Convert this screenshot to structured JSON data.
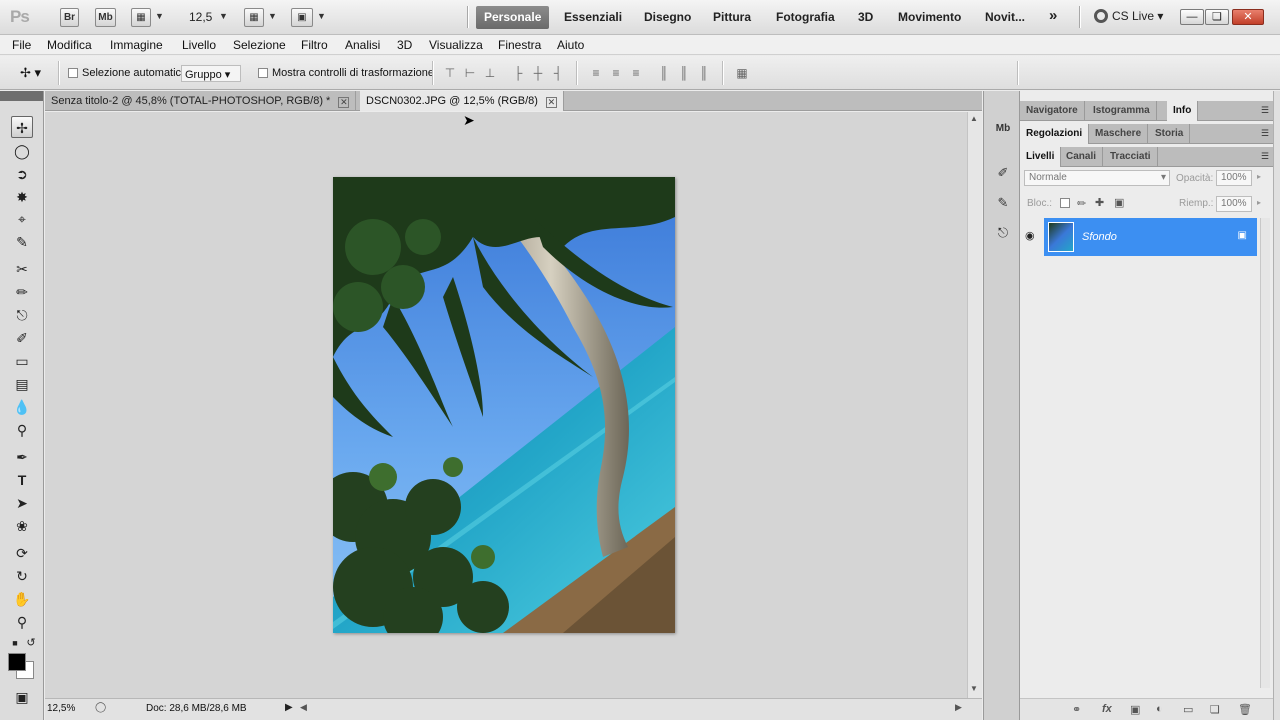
{
  "appbar": {
    "logo": "Ps",
    "br_button": "Br",
    "mb_button": "Mb",
    "zoom": "12,5",
    "workspaces": [
      "Personale",
      "Essenziali",
      "Disegno",
      "Pittura",
      "Fotografia",
      "3D",
      "Movimento",
      "Novit..."
    ],
    "more_icon": "»",
    "cslive": "CS Live",
    "window_buttons": [
      "minimize-icon",
      "restore-icon",
      "close-icon"
    ]
  },
  "menubar": {
    "items": [
      "File",
      "Modifica",
      "Immagine",
      "Livello",
      "Selezione",
      "Filtro",
      "Analisi",
      "3D",
      "Visualizza",
      "Finestra",
      "Aiuto"
    ]
  },
  "options": {
    "auto_select_label": "Selezione automatica:",
    "auto_select_value": "Gruppo",
    "show_transform_label": "Mostra controlli di trasformazione"
  },
  "tools": [
    "move-tool",
    "marquee-tool",
    "lasso-tool",
    "quick-selection-tool",
    "crop-tool",
    "eyedropper-tool",
    "healing-brush-tool",
    "brush-tool",
    "clone-stamp-tool",
    "history-brush-tool",
    "eraser-tool",
    "gradient-tool",
    "blur-tool",
    "dodge-tool",
    "pen-tool",
    "type-tool",
    "path-selection-tool",
    "custom-shape-tool",
    "3d-rotate-tool",
    "3d-orbit-tool",
    "hand-tool",
    "zoom-tool"
  ],
  "colors": {
    "foreground": "#000000",
    "background": "#ffffff",
    "layer_highlight": "#3c8ff2",
    "active_workspace": "#7a7a7a"
  },
  "document": {
    "tabs": [
      {
        "label": "Senza titolo-2 @ 45,8% (TOTAL-PHOTOSHOP, RGB/8) *"
      },
      {
        "label": "DSCN0302.JPG @ 12,5% (RGB/8)"
      }
    ]
  },
  "status": {
    "zoom": "12,5%",
    "doc_info": "Doc: 28,6 MB/28,6 MB"
  },
  "panels": {
    "top_tabs": [
      "Navigatore",
      "Istogramma",
      "Info"
    ],
    "mid_tabs": [
      "Regolazioni",
      "Maschere",
      "Storia"
    ],
    "layer_tabs": [
      "Livelli",
      "Canali",
      "Tracciati"
    ],
    "blend_mode": "Normale",
    "opacity_label": "Opacità:",
    "opacity_value": "100%",
    "lock_label": "Bloc.:",
    "fill_label": "Riemp.:",
    "fill_value": "100%",
    "layer_name": "Sfondo"
  }
}
